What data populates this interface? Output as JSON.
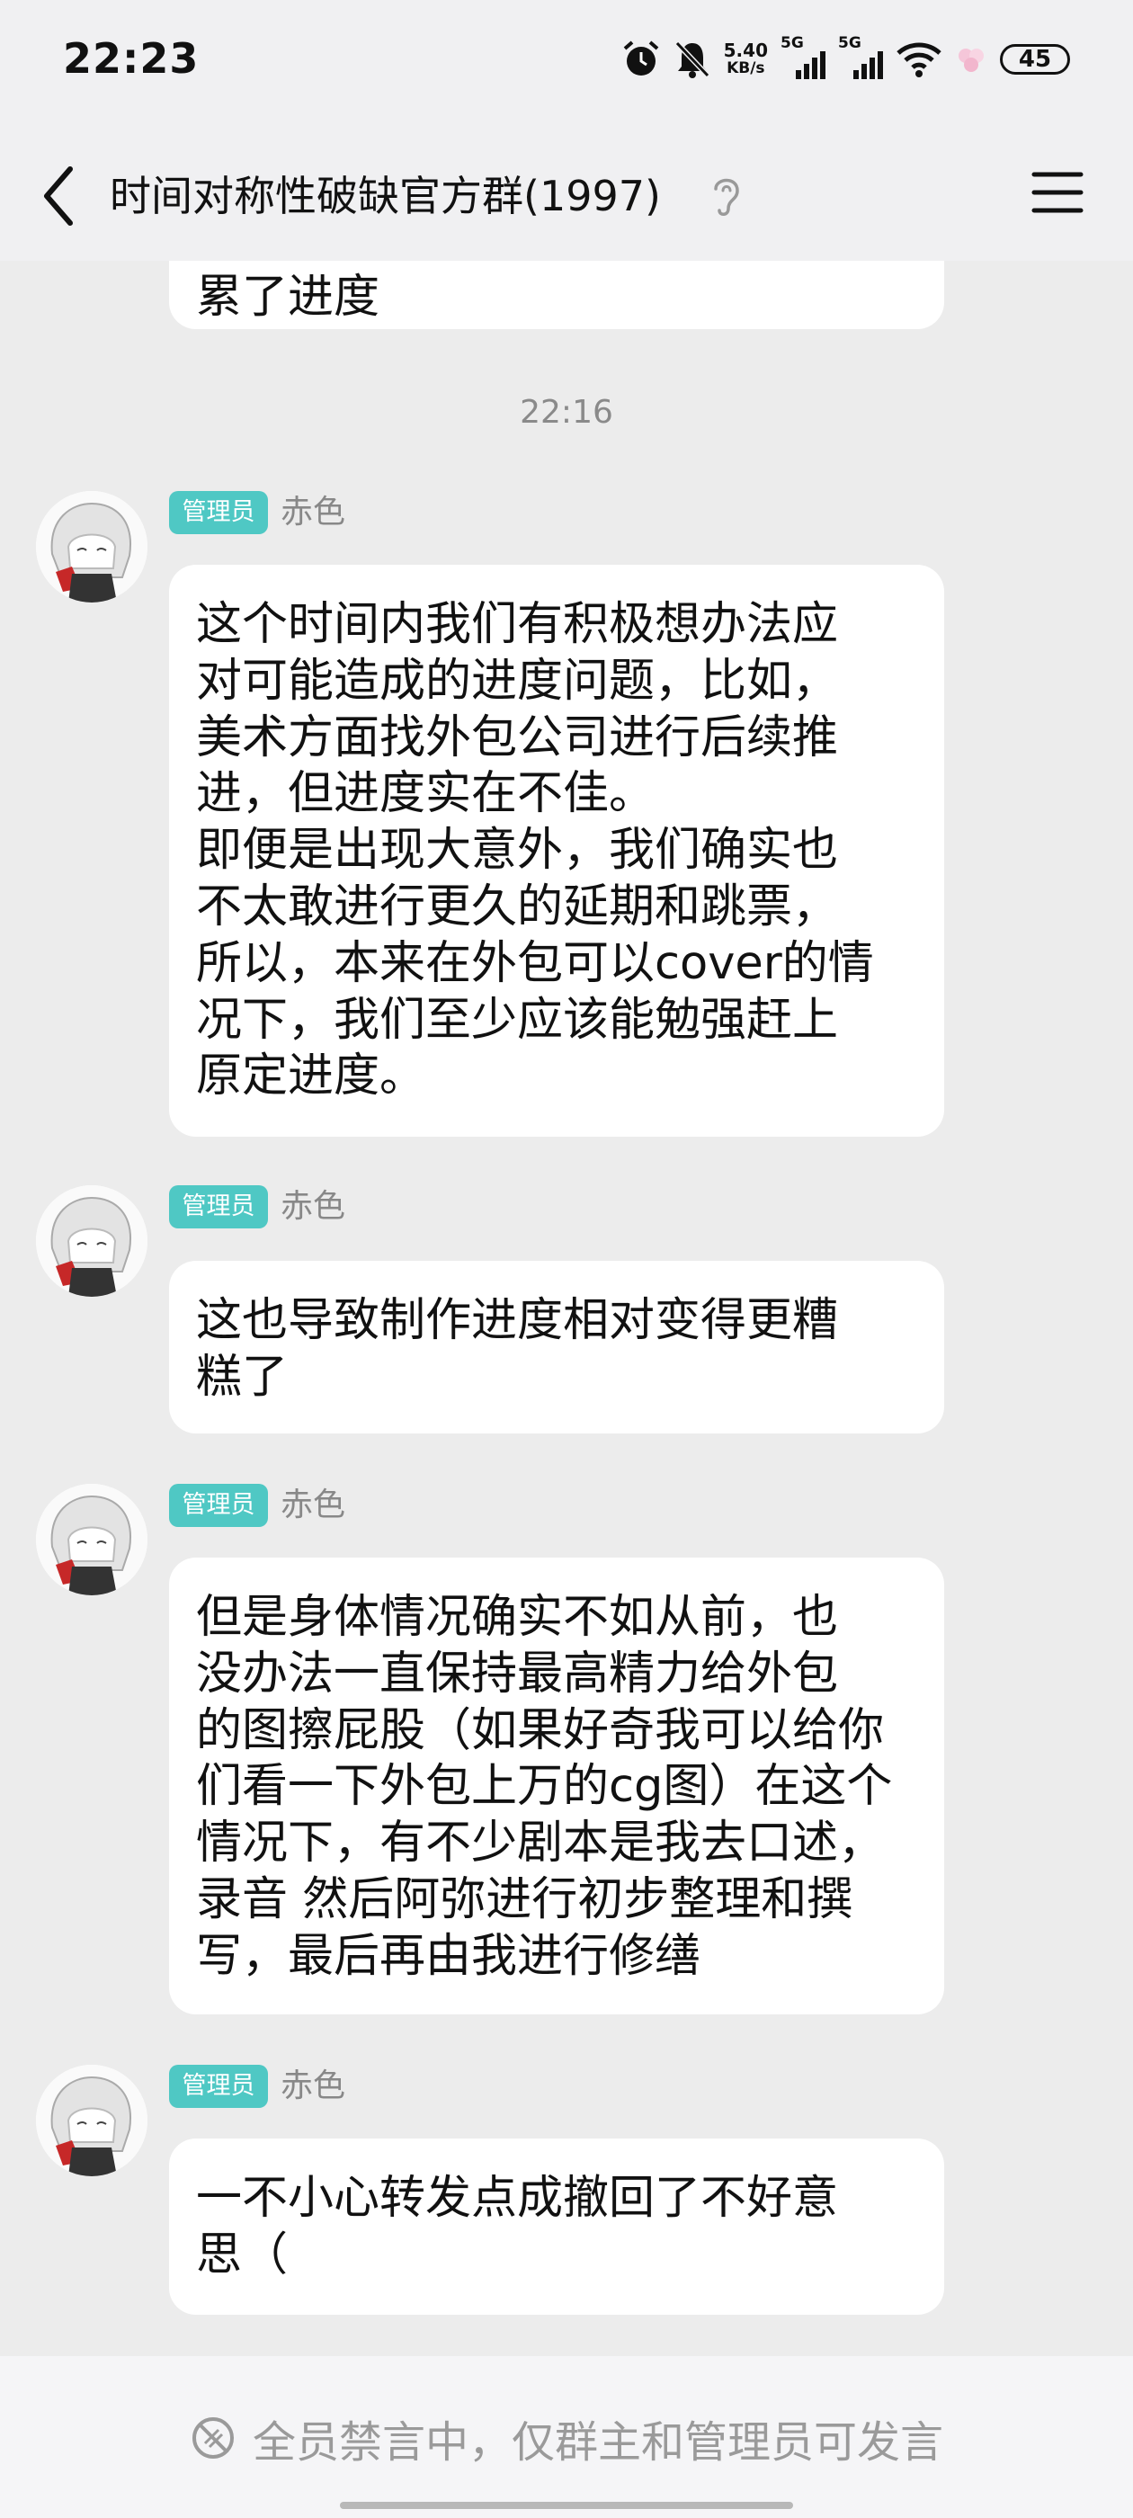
{
  "status_bar": {
    "time": "22:23",
    "net_speed_value": "5.40",
    "net_speed_unit": "KB/s",
    "sim1_label": "5G",
    "sim2_label": "5G",
    "battery": "45"
  },
  "header": {
    "title": "时间对称性破缺官方群(1997)"
  },
  "messages": [
    {
      "text": "累了进度"
    },
    {
      "timestamp": "22:16"
    },
    {
      "badge": "管理员",
      "sender": "赤色",
      "text": "这个时间内我们有积极想办法应\n对可能造成的进度问题，比如，\n美术方面找外包公司进行后续推\n进，但进度实在不佳。\n即便是出现大意外，我们确实也\n不太敢进行更久的延期和跳票，\n所以，本来在外包可以cover的情\n况下，我们至少应该能勉强赶上\n原定进度。"
    },
    {
      "badge": "管理员",
      "sender": "赤色",
      "text": "这也导致制作进度相对变得更糟\n糕了"
    },
    {
      "badge": "管理员",
      "sender": "赤色",
      "text": "但是身体情况确实不如从前，也\n没办法一直保持最高精力给外包\n的图擦屁股（如果好奇我可以给你\n们看一下外包上万的cg图）在这个\n情况下，有不少剧本是我去口述，\n录音 然后阿弥进行初步整理和撰\n写，最后再由我进行修缮"
    },
    {
      "badge": "管理员",
      "sender": "赤色",
      "text": "一不小心转发点成撤回了不好意\n思（"
    }
  ],
  "footer": {
    "mute_notice": "全员禁言中，仅群主和管理员可发言"
  }
}
